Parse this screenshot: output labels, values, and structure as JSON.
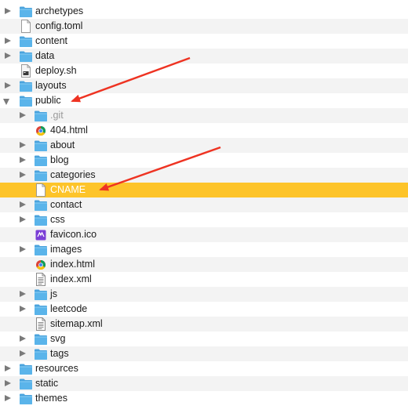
{
  "items": [
    {
      "label": "archetypes",
      "type": "folder",
      "level": 0,
      "expand": "closed"
    },
    {
      "label": "config.toml",
      "type": "file",
      "level": 0,
      "expand": "none"
    },
    {
      "label": "content",
      "type": "folder",
      "level": 0,
      "expand": "closed"
    },
    {
      "label": "data",
      "type": "folder",
      "level": 0,
      "expand": "closed"
    },
    {
      "label": "deploy.sh",
      "type": "script",
      "level": 0,
      "expand": "none"
    },
    {
      "label": "layouts",
      "type": "folder",
      "level": 0,
      "expand": "closed"
    },
    {
      "label": "public",
      "type": "folder",
      "level": 0,
      "expand": "open"
    },
    {
      "label": ".git",
      "type": "folder",
      "level": 1,
      "expand": "closed",
      "dim": true
    },
    {
      "label": "404.html",
      "type": "html",
      "level": 1,
      "expand": "none"
    },
    {
      "label": "about",
      "type": "folder",
      "level": 1,
      "expand": "closed"
    },
    {
      "label": "blog",
      "type": "folder",
      "level": 1,
      "expand": "closed"
    },
    {
      "label": "categories",
      "type": "folder",
      "level": 1,
      "expand": "closed"
    },
    {
      "label": "CNAME",
      "type": "file",
      "level": 1,
      "expand": "none",
      "selected": true
    },
    {
      "label": "contact",
      "type": "folder",
      "level": 1,
      "expand": "closed"
    },
    {
      "label": "css",
      "type": "folder",
      "level": 1,
      "expand": "closed"
    },
    {
      "label": "favicon.ico",
      "type": "ico",
      "level": 1,
      "expand": "none"
    },
    {
      "label": "images",
      "type": "folder",
      "level": 1,
      "expand": "closed"
    },
    {
      "label": "index.html",
      "type": "html",
      "level": 1,
      "expand": "none"
    },
    {
      "label": "index.xml",
      "type": "xml",
      "level": 1,
      "expand": "none"
    },
    {
      "label": "js",
      "type": "folder",
      "level": 1,
      "expand": "closed"
    },
    {
      "label": "leetcode",
      "type": "folder",
      "level": 1,
      "expand": "closed"
    },
    {
      "label": "sitemap.xml",
      "type": "xml",
      "level": 1,
      "expand": "none"
    },
    {
      "label": "svg",
      "type": "folder",
      "level": 1,
      "expand": "closed"
    },
    {
      "label": "tags",
      "type": "folder",
      "level": 1,
      "expand": "closed"
    },
    {
      "label": "resources",
      "type": "folder",
      "level": 0,
      "expand": "closed"
    },
    {
      "label": "static",
      "type": "folder",
      "level": 0,
      "expand": "closed"
    },
    {
      "label": "themes",
      "type": "folder",
      "level": 0,
      "expand": "closed"
    }
  ],
  "colors": {
    "selection": "#fdc42a",
    "folder": "#5ab4ea",
    "annotation_arrow": "#ee3322"
  },
  "annotations": [
    {
      "points_to": "public"
    },
    {
      "points_to": "CNAME"
    }
  ]
}
